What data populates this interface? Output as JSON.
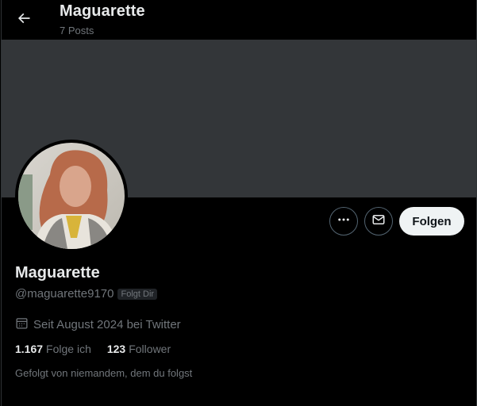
{
  "header": {
    "title": "Maguarette",
    "posts_count": "7 Posts",
    "back_icon": "arrow-left-icon"
  },
  "colors": {
    "background": "#000000",
    "banner": "#333639",
    "text_primary": "#e7e9ea",
    "text_secondary": "#71767b",
    "follow_button_bg": "#eff3f4",
    "follow_button_text": "#0f1419"
  },
  "actions": {
    "more_icon": "more-dots-icon",
    "message_icon": "envelope-icon",
    "follow_label": "Folgen"
  },
  "profile": {
    "display_name": "Maguarette",
    "handle": "@maguarette9170",
    "follows_you_badge": "Folgt Dir",
    "joined_icon": "calendar-icon",
    "joined_text": "Seit August 2024 bei Twitter",
    "following_count": "1.167",
    "following_label": "Folge ich",
    "followers_count": "123",
    "followers_label": "Follower",
    "followed_by_text": "Gefolgt von niemandem, dem du folgst"
  }
}
